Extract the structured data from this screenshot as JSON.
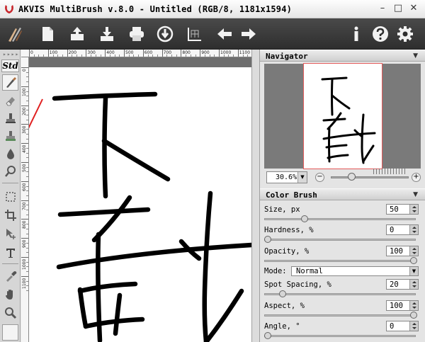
{
  "window": {
    "title": "AKVIS MultiBrush v.8.0 - Untitled (RGB/8, 1181x1594)",
    "minimize": "–",
    "maximize": "□",
    "close": "✕"
  },
  "toolbar": {
    "left_icons": [
      "brushes-logo-icon",
      "new-document-icon",
      "open-file-icon",
      "save-file-icon",
      "print-icon",
      "share-icon",
      "canvas-size-icon",
      "undo-arrow-icon",
      "redo-arrow-icon"
    ],
    "right_icons": [
      "info-icon",
      "help-icon",
      "settings-gear-icon"
    ],
    "colors": {
      "bg_top": "#4a4a4a",
      "bg_bottom": "#2e2e2e",
      "icon": "#f2f2f2"
    }
  },
  "tools": {
    "dots": "▸▸▸▸",
    "std_label": "Std",
    "items": [
      "brush-tool-icon",
      "eraser-tool-icon",
      "stamp-tool-icon",
      "smudge-tool-icon",
      "blur-drop-tool-icon",
      "magnifier-brush-icon",
      "selection-rect-icon",
      "crop-tool-icon",
      "move-tool-icon",
      "text-tool-icon",
      "eyedropper-icon",
      "hand-tool-icon",
      "zoom-tool-icon"
    ]
  },
  "rulers": {
    "top_labels": [
      "0",
      "100",
      "200",
      "300",
      "400",
      "500",
      "600",
      "700",
      "800",
      "900",
      "1000",
      "1100"
    ],
    "left_labels": [
      "0",
      "100",
      "200",
      "300",
      "400",
      "500",
      "600",
      "700",
      "800",
      "900",
      "1000",
      "1100"
    ]
  },
  "navigator": {
    "title": "Navigator",
    "zoom_value": "30.6%",
    "zoom_minus": "−",
    "zoom_plus": "+"
  },
  "color_brush": {
    "title": "Color Brush",
    "size": {
      "label": "Size, px",
      "value": "50",
      "fraction": 0.25
    },
    "hardness": {
      "label": "Hardness, %",
      "value": "0",
      "fraction": 0.0
    },
    "opacity": {
      "label": "Opacity, %",
      "value": "100",
      "fraction": 1.0
    },
    "mode": {
      "label": "Mode:",
      "value": "Normal"
    },
    "spot_spacing": {
      "label": "Spot Spacing, %",
      "value": "20",
      "fraction": 0.1
    },
    "aspect": {
      "label": "Aspect, %",
      "value": "100",
      "fraction": 1.0
    },
    "angle": {
      "label": "Angle, °",
      "value": "0",
      "fraction": 0.0
    }
  },
  "annotation": {
    "arrow_color": "#e02020"
  }
}
